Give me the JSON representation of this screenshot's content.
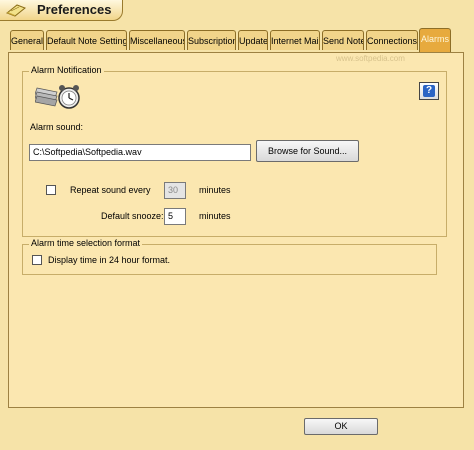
{
  "window": {
    "title": "Preferences",
    "watermark": "www.softpedia.com"
  },
  "tabs": [
    {
      "label": "General"
    },
    {
      "label": "Default Note Settings"
    },
    {
      "label": "Miscellaneous"
    },
    {
      "label": "Subscription"
    },
    {
      "label": "Update"
    },
    {
      "label": "Internet Mail"
    },
    {
      "label": "Send Note"
    },
    {
      "label": "Connections"
    },
    {
      "label": "Alarms",
      "active": true
    }
  ],
  "alarm_notification": {
    "group_title": "Alarm Notification",
    "help_label": "?",
    "sound_label": "Alarm sound:",
    "sound_path": "C:\\Softpedia\\Softpedia.wav",
    "browse_label": "Browse for Sound...",
    "repeat_label": "Repeat sound every",
    "repeat_checked": false,
    "repeat_value": "30",
    "repeat_units": "minutes",
    "snooze_label": "Default snooze:",
    "snooze_value": "5",
    "snooze_units": "minutes"
  },
  "time_format": {
    "group_title": "Alarm time selection format",
    "checkbox_label": "Display time in 24 hour format.",
    "checked": false
  },
  "footer": {
    "ok_label": "OK"
  },
  "colors": {
    "background": "#f6e3a8",
    "active_tab": "#e7aa3e",
    "panel": "#fbe7b0"
  }
}
